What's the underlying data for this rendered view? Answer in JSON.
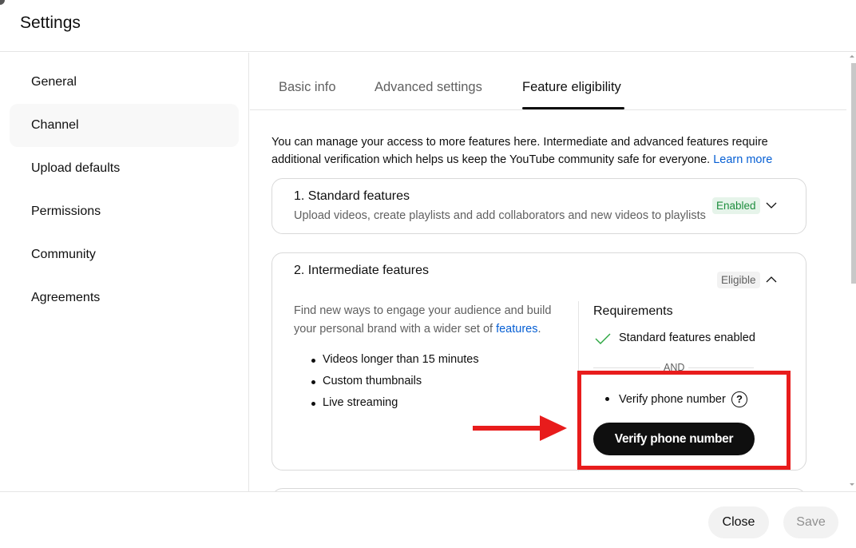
{
  "header": {
    "title": "Settings"
  },
  "sidebar": {
    "items": [
      {
        "label": "General",
        "active": false
      },
      {
        "label": "Channel",
        "active": true
      },
      {
        "label": "Upload defaults",
        "active": false
      },
      {
        "label": "Permissions",
        "active": false
      },
      {
        "label": "Community",
        "active": false
      },
      {
        "label": "Agreements",
        "active": false
      }
    ]
  },
  "tabs": [
    {
      "label": "Basic info",
      "active": false
    },
    {
      "label": "Advanced settings",
      "active": false
    },
    {
      "label": "Feature eligibility",
      "active": true
    }
  ],
  "intro": {
    "text": "You can manage your access to more features here. Intermediate and advanced features require additional verification which helps us keep the YouTube community safe for everyone.",
    "link": "Learn more"
  },
  "standard": {
    "title": "1. Standard features",
    "subtitle": "Upload videos, create playlists and add collaborators and new videos to playlists",
    "badge": "Enabled",
    "expand_icon": "chevron-down-icon"
  },
  "intermediate": {
    "title": "2. Intermediate features",
    "badge": "Eligible",
    "collapse_icon": "chevron-up-icon",
    "description": "Find new ways to engage your audience and build your personal brand with a wider set of",
    "description_link": "features",
    "description_end": ".",
    "features": [
      "Videos longer than 15 minutes",
      "Custom thumbnails",
      "Live streaming"
    ],
    "requirements": {
      "title": "Requirements",
      "met": "Standard features enabled",
      "separator": "AND",
      "pending": "Verify phone number",
      "help_icon": "?",
      "button": "Verify phone number"
    }
  },
  "footer": {
    "close": "Close",
    "save": "Save"
  },
  "colors": {
    "accent_link": "#065fd4",
    "enabled_green": "#1e8e3e",
    "annotation_red": "#e81c1c"
  }
}
